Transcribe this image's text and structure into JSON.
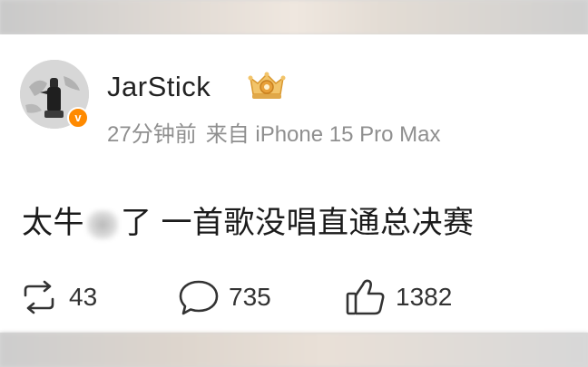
{
  "post": {
    "username": "JarStick",
    "meta": {
      "time": "27分钟前",
      "source": "来自 iPhone 15 Pro Max"
    },
    "text_before_blur": "太牛",
    "text_after_blur": "了 一首歌没唱直通总决赛"
  },
  "badges": {
    "verified_mark": "v",
    "verified_color": "#ff8a00",
    "medal_icon": "crown-medal-icon"
  },
  "actions": {
    "repost": {
      "icon": "repost-icon",
      "count": "43"
    },
    "comment": {
      "icon": "comment-icon",
      "count": "735"
    },
    "like": {
      "icon": "thumbs-up-icon",
      "count": "1382"
    }
  }
}
